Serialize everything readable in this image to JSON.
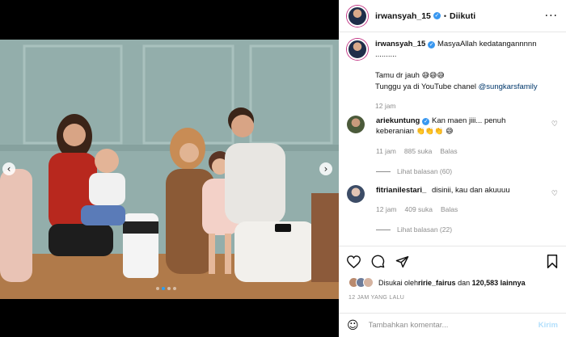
{
  "post": {
    "username": "irwansyah_15",
    "follow_status": "Diikuti",
    "separator": "•"
  },
  "media": {
    "prev_icon": "‹",
    "next_icon": "›",
    "dot_count": 4,
    "active_dot": 1
  },
  "caption": {
    "username": "irwansyah_15",
    "line1": "MasyaAllah kedatangannnnn ..........",
    "line2": "Tamu dr jauh",
    "line2_emoji": "😅😅😅",
    "line3_prefix": "Tunggu ya di YouTube chanel ",
    "line3_mention": "@sungkarsfamily",
    "time": "12 jam"
  },
  "comments": [
    {
      "username": "ariekuntung",
      "text": "Kan maen jiii... penuh keberanian",
      "emoji": "👏👏👏 😅",
      "time": "11 jam",
      "likes": "885 suka",
      "reply": "Balas",
      "view_replies": "Lihat balasan (60)"
    },
    {
      "username": "fitrianilestari_",
      "text": "disinii, kau dan akuuuu",
      "emoji": "",
      "time": "12 jam",
      "likes": "409 suka",
      "reply": "Balas",
      "view_replies": "Lihat balasan (22)"
    }
  ],
  "likes_line": {
    "prefix": "Disukai oleh ",
    "user": "ririe_fairus",
    "middle": " dan ",
    "count": "120,583 lainnya"
  },
  "posted_ago": "12 JAM YANG LALU",
  "add_comment": {
    "placeholder": "Tambahkan komentar...",
    "post_label": "Kirim",
    "emoji_icon": "☺"
  },
  "icons": {
    "more": "···",
    "heart_small": "♡"
  },
  "colors": {
    "accent": "#3897f0",
    "post_disabled": "#b2dffc",
    "muted": "#8e8e8e"
  }
}
